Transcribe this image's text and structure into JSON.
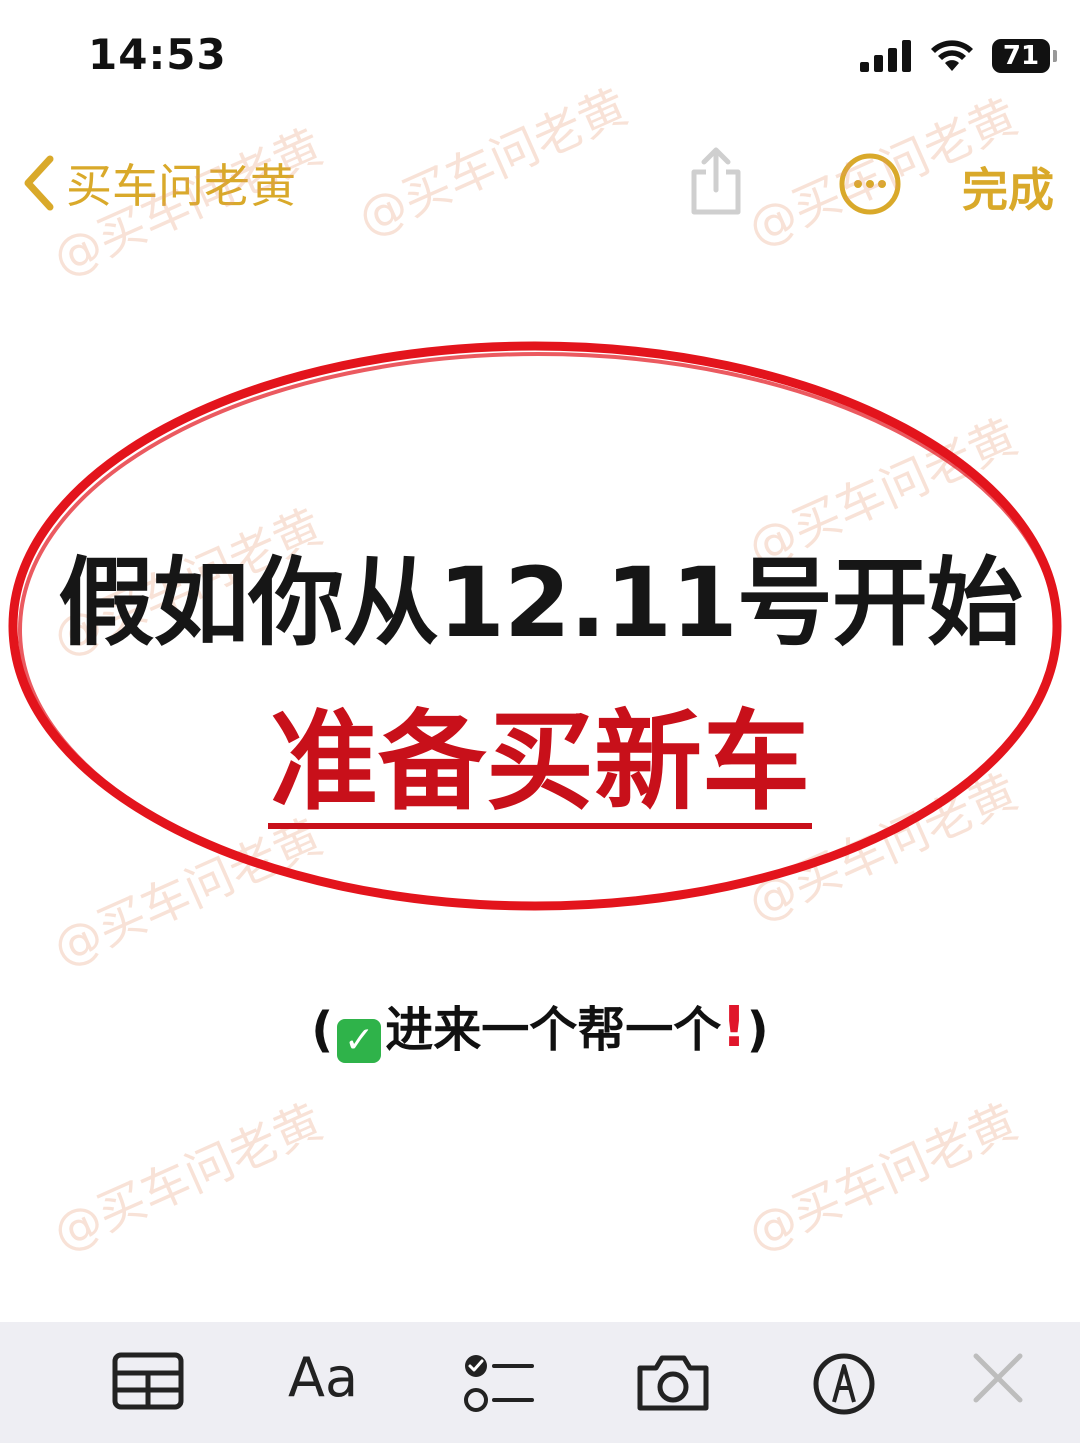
{
  "status_bar": {
    "time": "14:53",
    "battery": "71",
    "signal_icon": "cellular-signal-icon",
    "wifi_icon": "wifi-icon"
  },
  "nav": {
    "back_label": "买车问老黄",
    "done_label": "完成",
    "accent_color": "#d9a92a"
  },
  "watermark": {
    "text": "@买车问老黄"
  },
  "note": {
    "headline": "假如你从12.11号开始",
    "subhead": "准备买新车",
    "callout_open": "(",
    "callout_check": "✓",
    "callout_text": "进来一个帮一个",
    "callout_bang": "!",
    "callout_close": ")",
    "ellipse_color": "#e3141c",
    "subhead_color": "#c8101a"
  },
  "toolbar": {
    "aa_label": "Aa",
    "items": [
      "table-icon",
      "text-format-icon",
      "checklist-icon",
      "camera-icon",
      "markup-pen-icon",
      "close-icon"
    ]
  }
}
